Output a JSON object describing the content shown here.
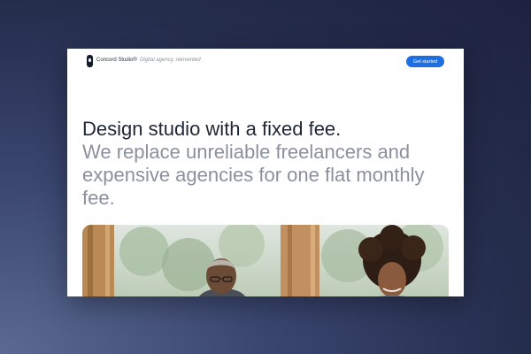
{
  "header": {
    "brand_name": "Concord Studio®",
    "tagline": "Digital agency, reinvented",
    "cta_label": "Get started"
  },
  "hero": {
    "headline": "Design studio with a fixed fee.",
    "subline": "We replace unreliable freelancers and expensive agencies for one flat monthly fee."
  },
  "colors": {
    "accent": "#1f6fe0",
    "headline_text": "#1e2636",
    "muted_text": "#8b919c",
    "background": "#252d4d"
  },
  "icons": {
    "logo": "brand-logo-mark"
  }
}
